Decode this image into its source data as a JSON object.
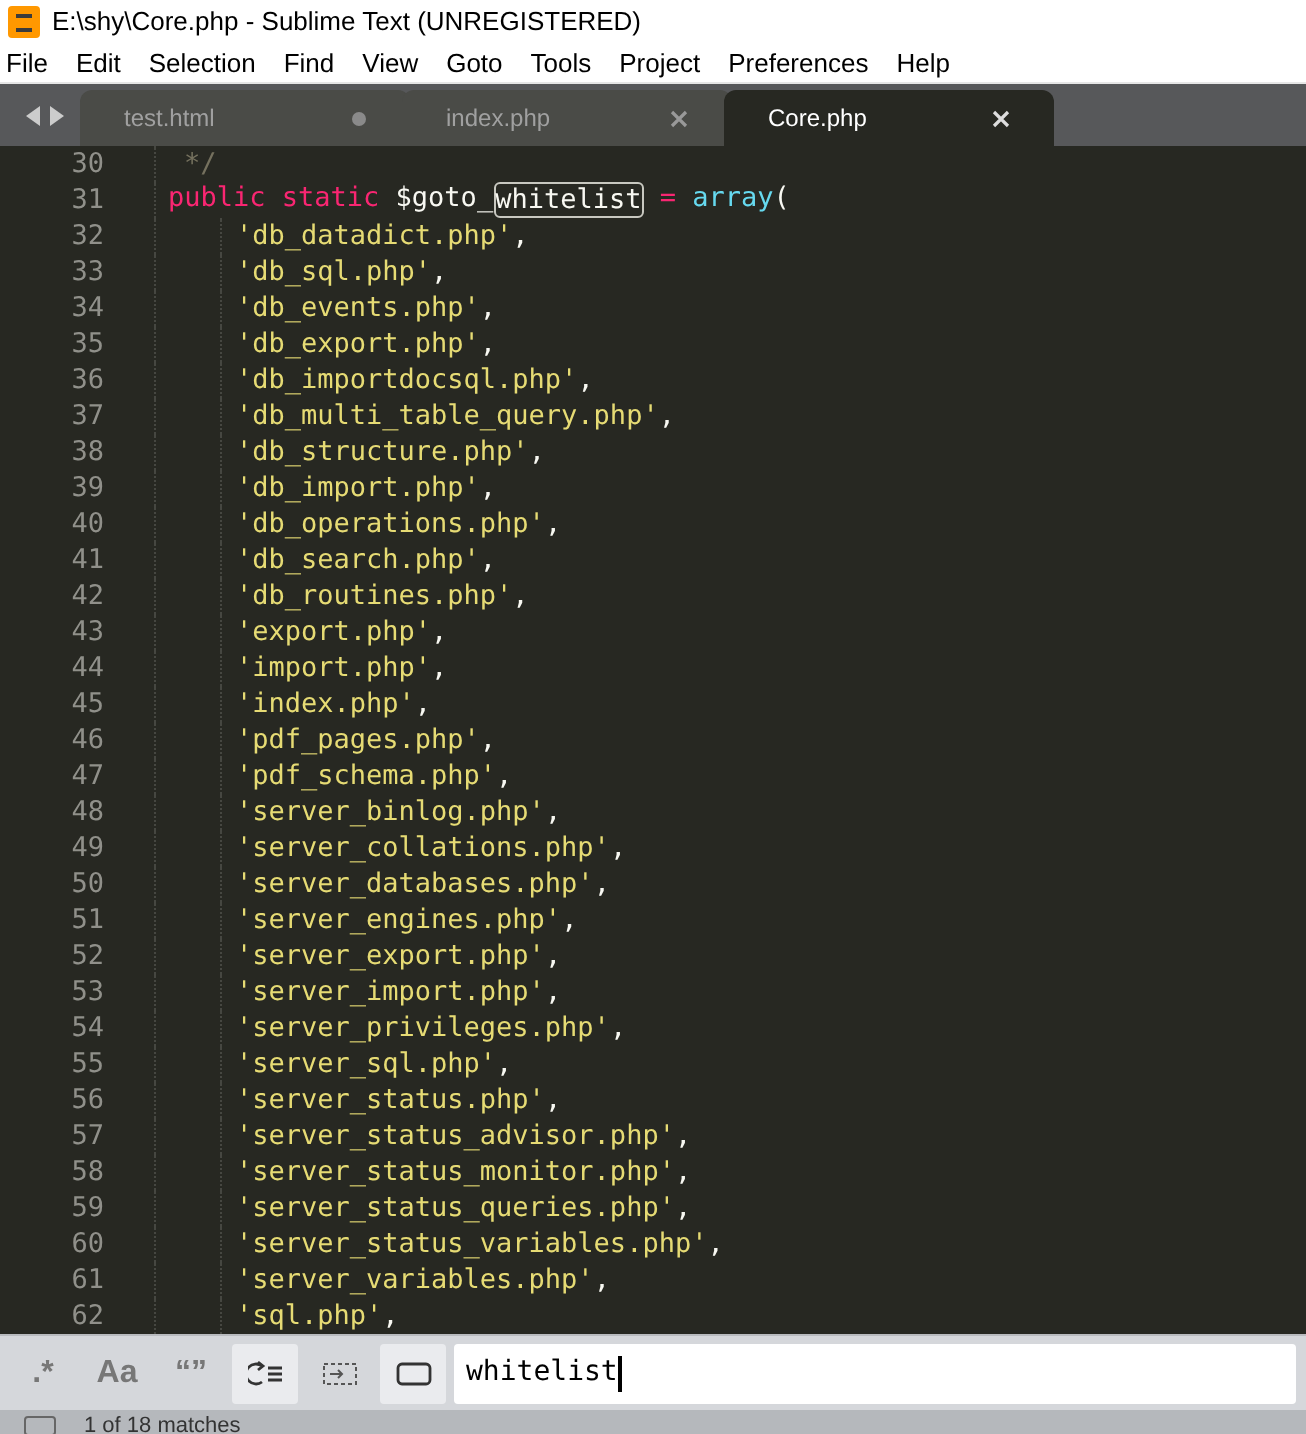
{
  "window": {
    "title": "E:\\shy\\Core.php - Sublime Text (UNREGISTERED)"
  },
  "menu": [
    "File",
    "Edit",
    "Selection",
    "Find",
    "View",
    "Goto",
    "Tools",
    "Project",
    "Preferences",
    "Help"
  ],
  "tabs": [
    {
      "label": "test.html",
      "selected": false,
      "dirty": true
    },
    {
      "label": "index.php",
      "selected": false,
      "dirty": false
    },
    {
      "label": "Core.php",
      "selected": true,
      "dirty": false
    }
  ],
  "lines": [
    {
      "number": "30",
      "kind": "comment",
      "tokens": [
        {
          "text": "*/",
          "kind": "comment"
        }
      ]
    },
    {
      "number": "31",
      "kind": "declaration",
      "tokens": [
        {
          "text": "public static",
          "kind": "keyword"
        },
        {
          "text": " $goto_",
          "kind": "plain"
        },
        {
          "text": "whitelist",
          "kind": "match"
        },
        {
          "text": " = ",
          "kind": "operator"
        },
        {
          "text": "array",
          "kind": "function"
        },
        {
          "text": "(",
          "kind": "plain"
        }
      ]
    },
    {
      "number": "32",
      "kind": "item",
      "tokens": [
        {
          "text": "'db_datadict.php'",
          "kind": "string"
        },
        {
          "text": ",",
          "kind": "plain"
        }
      ]
    },
    {
      "number": "33",
      "kind": "item",
      "tokens": [
        {
          "text": "'db_sql.php'",
          "kind": "string"
        },
        {
          "text": ",",
          "kind": "plain"
        }
      ]
    },
    {
      "number": "34",
      "kind": "item",
      "tokens": [
        {
          "text": "'db_events.php'",
          "kind": "string"
        },
        {
          "text": ",",
          "kind": "plain"
        }
      ]
    },
    {
      "number": "35",
      "kind": "item",
      "tokens": [
        {
          "text": "'db_export.php'",
          "kind": "string"
        },
        {
          "text": ",",
          "kind": "plain"
        }
      ]
    },
    {
      "number": "36",
      "kind": "item",
      "tokens": [
        {
          "text": "'db_importdocsql.php'",
          "kind": "string"
        },
        {
          "text": ",",
          "kind": "plain"
        }
      ]
    },
    {
      "number": "37",
      "kind": "item",
      "tokens": [
        {
          "text": "'db_multi_table_query.php'",
          "kind": "string"
        },
        {
          "text": ",",
          "kind": "plain"
        }
      ]
    },
    {
      "number": "38",
      "kind": "item",
      "tokens": [
        {
          "text": "'db_structure.php'",
          "kind": "string"
        },
        {
          "text": ",",
          "kind": "plain"
        }
      ]
    },
    {
      "number": "39",
      "kind": "item",
      "tokens": [
        {
          "text": "'db_import.php'",
          "kind": "string"
        },
        {
          "text": ",",
          "kind": "plain"
        }
      ]
    },
    {
      "number": "40",
      "kind": "item",
      "tokens": [
        {
          "text": "'db_operations.php'",
          "kind": "string"
        },
        {
          "text": ",",
          "kind": "plain"
        }
      ]
    },
    {
      "number": "41",
      "kind": "item",
      "tokens": [
        {
          "text": "'db_search.php'",
          "kind": "string"
        },
        {
          "text": ",",
          "kind": "plain"
        }
      ]
    },
    {
      "number": "42",
      "kind": "item",
      "tokens": [
        {
          "text": "'db_routines.php'",
          "kind": "string"
        },
        {
          "text": ",",
          "kind": "plain"
        }
      ]
    },
    {
      "number": "43",
      "kind": "item",
      "tokens": [
        {
          "text": "'export.php'",
          "kind": "string"
        },
        {
          "text": ",",
          "kind": "plain"
        }
      ]
    },
    {
      "number": "44",
      "kind": "item",
      "tokens": [
        {
          "text": "'import.php'",
          "kind": "string"
        },
        {
          "text": ",",
          "kind": "plain"
        }
      ]
    },
    {
      "number": "45",
      "kind": "item",
      "tokens": [
        {
          "text": "'index.php'",
          "kind": "string"
        },
        {
          "text": ",",
          "kind": "plain"
        }
      ]
    },
    {
      "number": "46",
      "kind": "item",
      "tokens": [
        {
          "text": "'pdf_pages.php'",
          "kind": "string"
        },
        {
          "text": ",",
          "kind": "plain"
        }
      ]
    },
    {
      "number": "47",
      "kind": "item",
      "tokens": [
        {
          "text": "'pdf_schema.php'",
          "kind": "string"
        },
        {
          "text": ",",
          "kind": "plain"
        }
      ]
    },
    {
      "number": "48",
      "kind": "item",
      "tokens": [
        {
          "text": "'server_binlog.php'",
          "kind": "string"
        },
        {
          "text": ",",
          "kind": "plain"
        }
      ]
    },
    {
      "number": "49",
      "kind": "item",
      "tokens": [
        {
          "text": "'server_collations.php'",
          "kind": "string"
        },
        {
          "text": ",",
          "kind": "plain"
        }
      ]
    },
    {
      "number": "50",
      "kind": "item",
      "tokens": [
        {
          "text": "'server_databases.php'",
          "kind": "string"
        },
        {
          "text": ",",
          "kind": "plain"
        }
      ]
    },
    {
      "number": "51",
      "kind": "item",
      "tokens": [
        {
          "text": "'server_engines.php'",
          "kind": "string"
        },
        {
          "text": ",",
          "kind": "plain"
        }
      ]
    },
    {
      "number": "52",
      "kind": "item",
      "tokens": [
        {
          "text": "'server_export.php'",
          "kind": "string"
        },
        {
          "text": ",",
          "kind": "plain"
        }
      ]
    },
    {
      "number": "53",
      "kind": "item",
      "tokens": [
        {
          "text": "'server_import.php'",
          "kind": "string"
        },
        {
          "text": ",",
          "kind": "plain"
        }
      ]
    },
    {
      "number": "54",
      "kind": "item",
      "tokens": [
        {
          "text": "'server_privileges.php'",
          "kind": "string"
        },
        {
          "text": ",",
          "kind": "plain"
        }
      ]
    },
    {
      "number": "55",
      "kind": "item",
      "tokens": [
        {
          "text": "'server_sql.php'",
          "kind": "string"
        },
        {
          "text": ",",
          "kind": "plain"
        }
      ]
    },
    {
      "number": "56",
      "kind": "item",
      "tokens": [
        {
          "text": "'server_status.php'",
          "kind": "string"
        },
        {
          "text": ",",
          "kind": "plain"
        }
      ]
    },
    {
      "number": "57",
      "kind": "item",
      "tokens": [
        {
          "text": "'server_status_advisor.php'",
          "kind": "string"
        },
        {
          "text": ",",
          "kind": "plain"
        }
      ]
    },
    {
      "number": "58",
      "kind": "item",
      "tokens": [
        {
          "text": "'server_status_monitor.php'",
          "kind": "string"
        },
        {
          "text": ",",
          "kind": "plain"
        }
      ]
    },
    {
      "number": "59",
      "kind": "item",
      "tokens": [
        {
          "text": "'server_status_queries.php'",
          "kind": "string"
        },
        {
          "text": ",",
          "kind": "plain"
        }
      ]
    },
    {
      "number": "60",
      "kind": "item",
      "tokens": [
        {
          "text": "'server_status_variables.php'",
          "kind": "string"
        },
        {
          "text": ",",
          "kind": "plain"
        }
      ]
    },
    {
      "number": "61",
      "kind": "item",
      "tokens": [
        {
          "text": "'server_variables.php'",
          "kind": "string"
        },
        {
          "text": ",",
          "kind": "plain"
        }
      ]
    },
    {
      "number": "62",
      "kind": "item",
      "tokens": [
        {
          "text": "'sql.php'",
          "kind": "string"
        },
        {
          "text": ",",
          "kind": "plain"
        }
      ]
    }
  ],
  "find": {
    "options": [
      {
        "kind": "regex",
        "label": ".*",
        "on": false
      },
      {
        "kind": "case",
        "label": "Aa",
        "on": false
      },
      {
        "kind": "word",
        "label": "“”",
        "on": false
      },
      {
        "kind": "wrap",
        "on": true
      },
      {
        "kind": "in_selection",
        "on": false
      },
      {
        "kind": "highlight",
        "on": true
      }
    ],
    "value": "whitelist"
  },
  "status_bar": {
    "text": "1 of 18 matches"
  }
}
